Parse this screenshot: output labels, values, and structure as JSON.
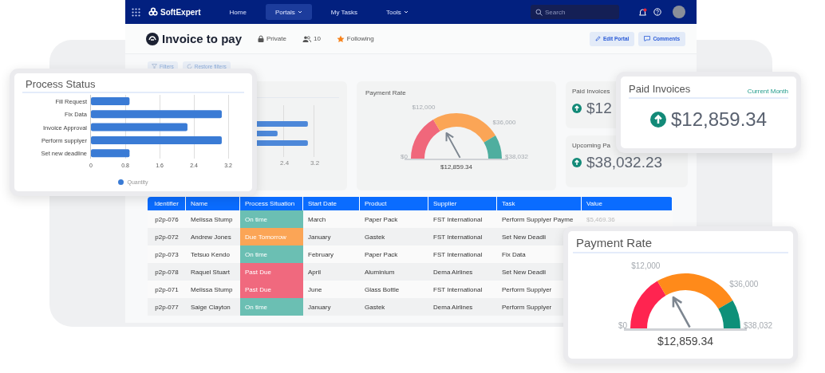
{
  "nav": {
    "logo": "SoftExpert",
    "items": [
      {
        "label": "Home",
        "selected": false,
        "caret": false
      },
      {
        "label": "Portals",
        "selected": true,
        "caret": true
      },
      {
        "label": "My Tasks",
        "selected": false,
        "caret": false
      },
      {
        "label": "Tools",
        "selected": false,
        "caret": true
      }
    ],
    "search": {
      "placeholder": "Search"
    }
  },
  "portal": {
    "title": "Invoice to pay",
    "privacy": "Private",
    "members": "10",
    "follow": "Following",
    "buttons": [
      {
        "kind": "edit",
        "label": "Edit Portal"
      },
      {
        "kind": "comments",
        "label": "Comments"
      }
    ]
  },
  "filters": [
    {
      "kind": "filter",
      "label": "Filters"
    },
    {
      "kind": "restore",
      "label": "Restore filters"
    }
  ],
  "background_chart": {
    "xticks": [
      "2.4",
      "3.2"
    ]
  },
  "payment_rate": {
    "title": "Payment Rate",
    "labels": [
      "$0",
      "$12,000",
      "$36,000",
      "$38,032"
    ],
    "segments": [
      {
        "color": "#f0677b"
      },
      {
        "color": "#fba556"
      },
      {
        "color": "#4fae9f"
      }
    ],
    "level": 0.34,
    "value": "$12,859.34"
  },
  "paid_invoices": {
    "title": "Paid Invoices",
    "value": "$12"
  },
  "upcoming_payments": {
    "title": "Upcoming Pa",
    "value": "$38,032.23"
  },
  "table": {
    "columns": [
      "Identifier",
      "Name",
      "Process Situation",
      "Start Date",
      "Product",
      "Supplier",
      "Task",
      "Value"
    ],
    "rows": [
      {
        "identifier": "p2p-076",
        "name": "Melissa Stump",
        "status": {
          "text": "On time",
          "color": "#6bbfb3"
        },
        "start_date": "March",
        "product": "Paper Pack",
        "supplier": "FST International",
        "task": "Perform Supplyer Payme",
        "value": "$5,469.36"
      },
      {
        "identifier": "p2p-072",
        "name": "Andrew Jones",
        "status": {
          "text": "Due Tomorrow",
          "color": "#fba556"
        },
        "start_date": "January",
        "product": "Gastek",
        "supplier": "FST International",
        "task": "Set New Deadli"
      },
      {
        "identifier": "p2p-073",
        "name": "Tetsuo Kendo",
        "status": {
          "text": "On time",
          "color": "#6bbfb3"
        },
        "start_date": "February",
        "product": "Paper Pack",
        "supplier": "FST International",
        "task": "Fix Data"
      },
      {
        "identifier": "p2p-078",
        "name": "Raquel Stuart",
        "status": {
          "text": "Past Due",
          "color": "#f0697e"
        },
        "start_date": "April",
        "product": "Aluminium",
        "supplier": "Dema Airlines",
        "task": "Set New Deadli"
      },
      {
        "identifier": "p2p-071",
        "name": "Melissa Stump",
        "status": {
          "text": "Past Due",
          "color": "#f0697e"
        },
        "start_date": "June",
        "product": "Glass Bottle",
        "supplier": "FST International",
        "task": "Perform Supplyer"
      },
      {
        "identifier": "p2p-077",
        "name": "Saige Clayton",
        "status": {
          "text": "On time",
          "color": "#6bbfb3"
        },
        "start_date": "January",
        "product": "Gastek",
        "supplier": "Dema Airlines",
        "task": "Perform Supplyer"
      }
    ]
  },
  "process_status": {
    "title": "Process Status",
    "chart_data": {
      "type": "bar",
      "orientation": "horizontal",
      "categories": [
        "Fill Request",
        "Fix Data",
        "Invoice Approval",
        "Perform supplyer",
        "Set new deadline"
      ],
      "series": [
        {
          "name": "Quantity",
          "color": "#3a7bd5",
          "values": [
            0.9,
            3.05,
            2.25,
            3.05,
            0.9
          ]
        }
      ],
      "xlim": [
        0,
        3.2
      ],
      "xticks": [
        0,
        0.8,
        1.6,
        2.4,
        3.2
      ]
    }
  },
  "paid_invoices_card": {
    "title": "Paid Invoices",
    "period": "Current Month",
    "value": "$12,859.34"
  },
  "payment_rate_card": {
    "title": "Payment Rate",
    "labels": [
      "$0",
      "$12,000",
      "$36,000",
      "$38,032"
    ],
    "segments": [
      {
        "color": "#ff2450"
      },
      {
        "color": "#ff8a1a"
      },
      {
        "color": "#0e9079"
      }
    ],
    "level": 0.34,
    "value": "$12,859.34"
  }
}
